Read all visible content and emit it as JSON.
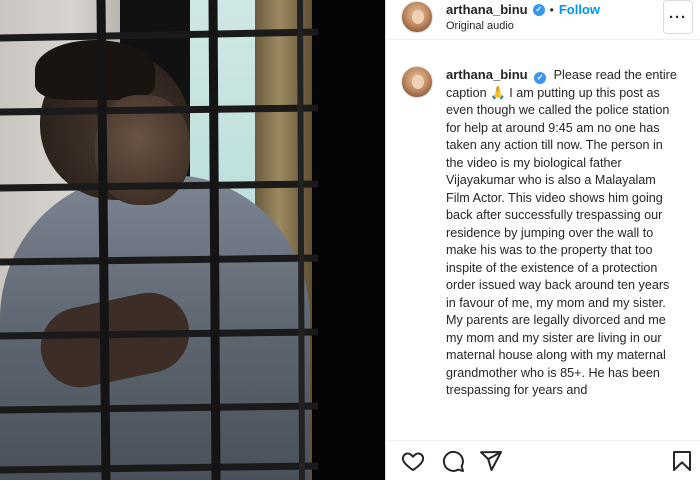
{
  "post": {
    "author": "arthana_binu",
    "follow_label": "Follow",
    "separator": "•",
    "audio": "Original audio",
    "more_label": "···"
  },
  "caption": {
    "author": "arthana_binu",
    "text": "Please read the entire caption 🙏 I am putting up this post as even though we called the police station for help at around 9:45 am no one has taken any action till now. The person in the video is my biological father Vijayakumar who is also a Malayalam Film Actor. This video shows him going back after successfully trespassing our residence by jumping over the wall to make his was to the property that too inspite of the existence of a protection order issued way back around ten years in favour of me, my mom and my sister. My parents are legally divorced and me my mom and my sister are living in our maternal house along with my maternal grandmother who is 85+. He has been trespassing for years and"
  },
  "icons": {
    "verified": "✓",
    "like": "heart-icon",
    "comment": "comment-icon",
    "share": "share-icon",
    "save": "bookmark-icon"
  },
  "colors": {
    "accent": "#0095f6",
    "verified": "#3897f0",
    "text": "#262626"
  }
}
